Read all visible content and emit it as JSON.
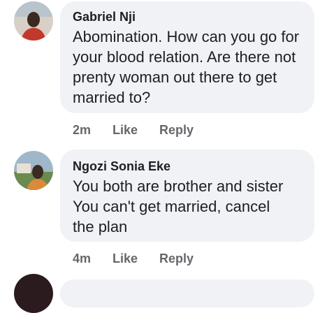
{
  "comments": [
    {
      "author": "Gabriel Nji",
      "text": "Abomination. How can you go for your blood relation. Are there not prenty woman out there to get married to?",
      "time": "2m",
      "like": "Like",
      "reply": "Reply",
      "avatar_icon": "avatar-photo-icon"
    },
    {
      "author": "Ngozi Sonia Eke",
      "text": "You both are brother and sister You can't get married, cancel the plan",
      "time": "4m",
      "like": "Like",
      "reply": "Reply",
      "avatar_icon": "avatar-photo-icon"
    }
  ],
  "colors": {
    "bubble": "#f0f2f5",
    "text": "#1c1e21",
    "meta": "#65676b"
  }
}
